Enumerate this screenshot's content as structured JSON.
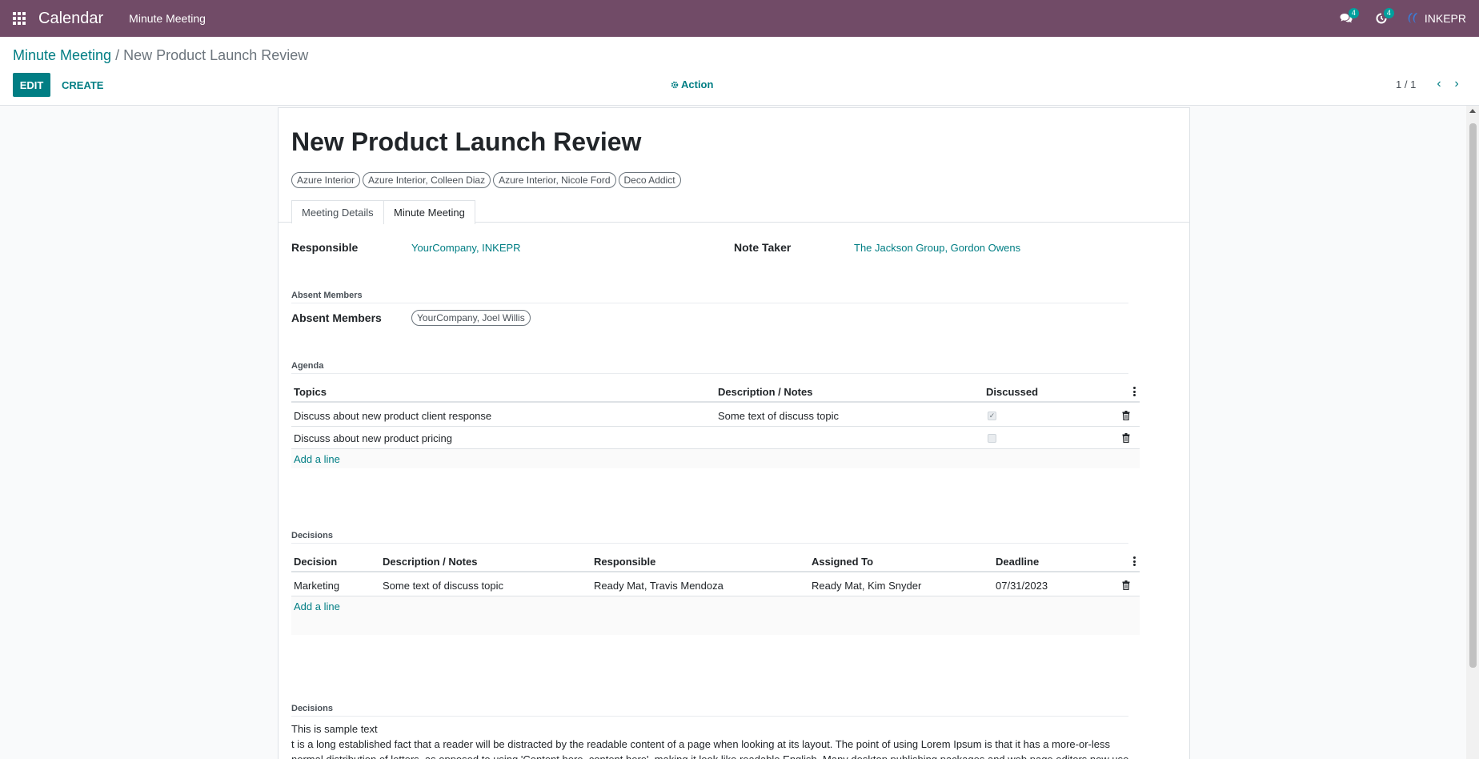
{
  "navbar": {
    "app_name": "Calendar",
    "menu_item": "Minute Meeting",
    "messages_count": "4",
    "activities_count": "4",
    "user_name": "INKEPR"
  },
  "control_panel": {
    "breadcrumb_parent": "Minute Meeting",
    "breadcrumb_separator": "/",
    "breadcrumb_current": "New Product Launch Review",
    "edit_label": "EDIT",
    "create_label": "CREATE",
    "action_label": "Action",
    "pager_value": "1 / 1"
  },
  "record": {
    "title": "New Product Launch Review",
    "attendees": [
      "Azure Interior",
      "Azure Interior, Colleen Diaz",
      "Azure Interior, Nicole Ford",
      "Deco Addict"
    ],
    "tabs": [
      "Meeting Details",
      "Minute Meeting"
    ],
    "active_tab": "Minute Meeting",
    "responsible_label": "Responsible",
    "responsible_value": "YourCompany, INKEPR",
    "note_taker_label": "Note Taker",
    "note_taker_value": "The Jackson Group, Gordon Owens",
    "absent_section_title": "Absent Members",
    "absent_label": "Absent Members",
    "absent_tag": "YourCompany, Joel Willis"
  },
  "agenda": {
    "section_title": "Agenda",
    "columns": [
      "Topics",
      "Description / Notes",
      "Discussed"
    ],
    "rows": [
      {
        "topic": "Discuss about new product client response",
        "notes": "Some text of discuss topic",
        "discussed": true
      },
      {
        "topic": "Discuss about new product pricing",
        "notes": "",
        "discussed": false
      }
    ],
    "add_line": "Add a line"
  },
  "decisions": {
    "section_title": "Decisions",
    "columns": [
      "Decision",
      "Description / Notes",
      "Responsible",
      "Assigned To",
      "Deadline"
    ],
    "rows": [
      {
        "decision": "Marketing",
        "notes": "Some text of discuss topic",
        "responsible": "Ready Mat, Travis Mendoza",
        "assigned_to": "Ready Mat, Kim Snyder",
        "deadline": "07/31/2023"
      }
    ],
    "add_line": "Add a line"
  },
  "decisions_notes": {
    "section_title": "Decisions",
    "line1": "This is sample text",
    "line2": "t is a long established fact that a reader will be distracted by the readable content of a page when looking at its layout. The point of using Lorem Ipsum is that it has a more-or-less",
    "line3": "normal distribution of letters, as opposed to using 'Content here, content here', making it look like readable English. Many desktop publishing packages and web page editors now use"
  },
  "colors": {
    "navbar": "#714b67",
    "primary": "#017e84",
    "badge": "#00a09d"
  }
}
